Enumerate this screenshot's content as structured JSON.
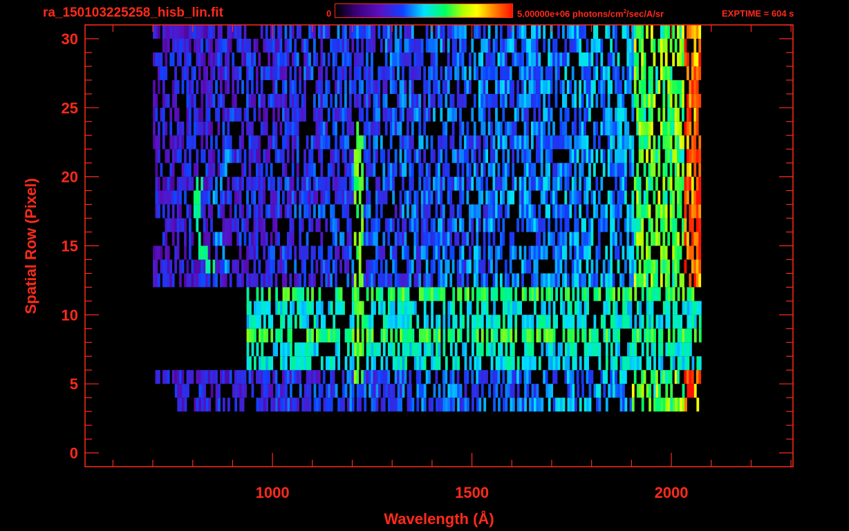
{
  "header": {
    "title": "ra_150103225258_hisb_lin.fit",
    "colorbar_min": "0",
    "colorbar_max_label": "5.00000e+06 photons/cm",
    "colorbar_max_exp": "2",
    "colorbar_max_unit": "/sec/A/sr",
    "exptime": "EXPTIME = 604 s"
  },
  "colors": {
    "axis": "#ff2a1a",
    "background": "#000000"
  },
  "chart_data": {
    "type": "heatmap",
    "xlabel": "Wavelength (Å)",
    "ylabel": "Spatial Row (Pixel)",
    "xlim": [
      530,
      2305
    ],
    "ylim": [
      -1,
      31
    ],
    "xticks": [
      1000,
      1500,
      2000
    ],
    "yticks": [
      0,
      5,
      10,
      15,
      20,
      25,
      30
    ],
    "data_extent": {
      "wavelength": [
        700,
        2070
      ],
      "rows": [
        0,
        30
      ]
    },
    "colorbar": {
      "min": 0,
      "max": 5000000,
      "unit": "photons/cm^2/sec/A/sr"
    },
    "features": [
      {
        "kind": "bright continuum band",
        "rows": [
          6,
          12
        ],
        "wavelength": [
          935,
          2070
        ]
      },
      {
        "kind": "emission line (vertical)",
        "wavelength": 1215,
        "rows": [
          5,
          24
        ]
      },
      {
        "kind": "arc feature",
        "wavelength": [
          800,
          870
        ],
        "rows": [
          13,
          22
        ]
      }
    ]
  }
}
